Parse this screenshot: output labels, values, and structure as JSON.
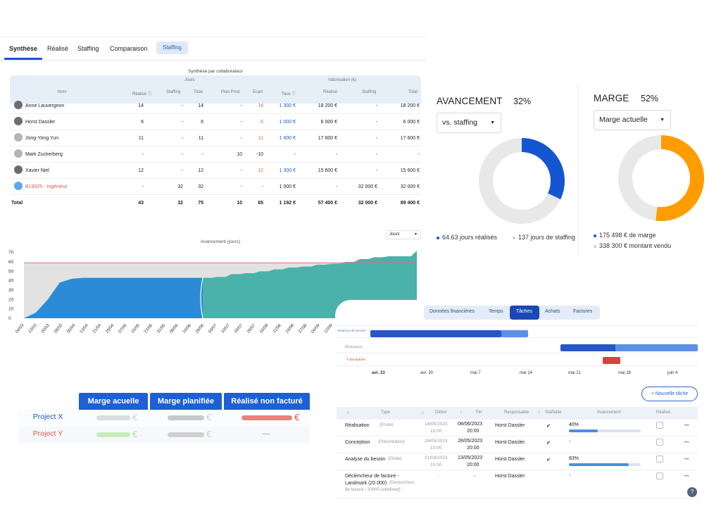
{
  "tabs": {
    "items": [
      "Synthèse",
      "Réalisé",
      "Staffing",
      "Comparaison"
    ],
    "pill": "Staffing"
  },
  "collab_table": {
    "title": "Synthèse par collaborateur",
    "group_jours": "Jours",
    "group_valo": "Valorisation (€)",
    "columns": [
      "Nom",
      "Réalisé ⓘ",
      "Staffing",
      "Total",
      "Plan Prod.",
      "Ecart",
      "Taux ⓘ",
      "Réalisé",
      "Staffing",
      "Total"
    ],
    "rows": [
      {
        "name": "Anne Lauvergeon",
        "realise": "14",
        "staffing": "-",
        "total": "14",
        "plan": "-",
        "ecart": "14",
        "taux": "1 300 €",
        "v_realise": "18 200 €",
        "v_staffing": "-",
        "v_total": "18 200 €"
      },
      {
        "name": "Horst Dassler",
        "realise": "6",
        "staffing": "-",
        "total": "6",
        "plan": "-",
        "ecart": "6",
        "taux": "1 000 €",
        "v_realise": "6 000 €",
        "v_staffing": "-",
        "v_total": "6 000 €"
      },
      {
        "name": "Jong-Yong Yun",
        "realise": "11",
        "staffing": "-",
        "total": "11",
        "plan": "-",
        "ecart": "11",
        "taux": "1 600 €",
        "v_realise": "17 600 €",
        "v_staffing": "-",
        "v_total": "17 600 €"
      },
      {
        "name": "Mark Zuckerberg",
        "realise": "-",
        "staffing": "-",
        "total": "-",
        "plan": "10",
        "ecart": "-10",
        "taux": "-",
        "v_realise": "-",
        "v_staffing": "-",
        "v_total": "-"
      },
      {
        "name": "Xavier Niel",
        "realise": "12",
        "staffing": "-",
        "total": "12",
        "plan": "-",
        "ecart": "12",
        "taux": "1 300 €",
        "v_realise": "15 600 €",
        "v_staffing": "-",
        "v_total": "15 600 €"
      },
      {
        "name": "B19325 - Ingénieur",
        "realise": "-",
        "staffing": "32",
        "total": "32",
        "plan": "-",
        "ecart": "-",
        "taux": "1 000 €",
        "v_realise": "-",
        "v_staffing": "32 000 €",
        "v_total": "32 000 €"
      }
    ],
    "total_row": {
      "name": "Total",
      "realise": "43",
      "staffing": "32",
      "total": "75",
      "plan": "10",
      "ecart": "65",
      "taux": "1 192 €",
      "v_realise": "57 400 €",
      "v_staffing": "32 000 €",
      "v_total": "89 400 €"
    }
  },
  "chart_data": [
    {
      "type": "area",
      "title": "Avancement (jours)",
      "yticks": [
        0,
        10,
        20,
        30,
        40,
        50,
        60,
        70
      ],
      "ylim": [
        0,
        72
      ],
      "xticks": [
        "04/03",
        "13/03",
        "20/03",
        "28/03",
        "05/04",
        "13/04",
        "21/04",
        "29/04",
        "07/05",
        "15/05",
        "23/05",
        "31/05",
        "08/06",
        "16/06",
        "26/06",
        "03/07",
        "10/07",
        "18/07",
        "26/07",
        "03/08",
        "11/08",
        "19/08",
        "27/08",
        "04/09",
        "12/09",
        "20/09",
        "28/09",
        "06/10",
        "14/10",
        "22/10",
        "30/10"
      ],
      "series": [
        {
          "name": "Réalisé",
          "color": "#2b8bd6",
          "values": [
            0,
            6,
            20,
            38,
            42,
            43,
            43,
            43,
            43,
            43,
            43,
            43,
            43,
            43,
            43,
            43
          ]
        },
        {
          "name": "Staffing",
          "color": "#4ab2aa",
          "values": [
            43,
            44,
            47,
            48,
            50,
            52,
            54,
            55,
            57,
            58,
            60,
            63,
            65,
            66,
            66,
            72
          ]
        }
      ],
      "reference_line": {
        "value": 59,
        "color": "#e07078"
      },
      "background_area": {
        "value": 59,
        "color": "#e2e2e2"
      },
      "period_selector": "Jours"
    },
    {
      "type": "pie",
      "title": "AVANCEMENT",
      "percent": "32%",
      "selector": "vs. staffing",
      "values": [
        32,
        68
      ],
      "colors": [
        "#1456d0",
        "#e8e8e8"
      ],
      "legend": [
        "64.63 jours réalisés",
        "137 jours de staffing"
      ]
    },
    {
      "type": "pie",
      "title": "MARGE",
      "percent": "52%",
      "selector": "Marge actuelle",
      "values": [
        52,
        48
      ],
      "colors": [
        "#ff9d00",
        "#e8e8e8"
      ],
      "legend": [
        "175 498 € de marge",
        "338 300 € montant vendu"
      ]
    }
  ],
  "marge_table": {
    "headers": [
      "Marge acuelle",
      "Marge planifiée",
      "Réalisé non facturé"
    ],
    "rows": [
      {
        "label": "Project X",
        "label_color": "#2656b8",
        "bars": [
          "#dcdcdc",
          "#c8c8c8",
          "#e8837b"
        ],
        "euro_colors": [
          "#d0d0d0",
          "#d0d0d0",
          "#e0584c"
        ],
        "third": "€"
      },
      {
        "label": "Project Y",
        "label_color": "#e0584c",
        "bars": [
          "#c7ebb8",
          "#d0d0d0",
          ""
        ],
        "euro_colors": [
          "#b9dda8",
          "#d0d0d0",
          ""
        ],
        "third": "—"
      }
    ],
    "euro_symbol": "€"
  },
  "tasks_panel": {
    "tabs": [
      "Données financières",
      "Temps",
      "Tâches",
      "Achats",
      "Factures"
    ],
    "gantt": {
      "rows": [
        "Analyse du besoin",
        "Réalisation",
        "Conception"
      ],
      "axis": [
        "avr. 23",
        "avr. 30",
        "mai 7",
        "mai 14",
        "mai 21",
        "mai 28",
        "juin 4"
      ]
    },
    "new_task_button": "+ Nouvelle tâche",
    "columns": [
      "Type",
      "Début",
      "Fin",
      "Responsable",
      "Staffable",
      "Avancement",
      "Réalisé"
    ],
    "rows": [
      {
        "type": "Réalisation",
        "sub": "(Etude)",
        "start": "18/05/2023",
        "start_time": "10:00",
        "end": "08/06/2023",
        "end_time": "20:00",
        "owner": "Horst Dassler",
        "staffable": "✔",
        "progress_label": "40%",
        "progress": 0.4
      },
      {
        "type": "Conception",
        "sub": "(Présentation)",
        "start": "24/05/2023",
        "start_time": "10:00",
        "end": "28/05/2023",
        "end_time": "20:00",
        "owner": "Horst Dassler",
        "staffable": "✔",
        "progress_label": "-",
        "progress": null
      },
      {
        "type": "Analyse du besoin",
        "sub": "(Etude)",
        "start": "21/04/2023",
        "start_time": "10:00",
        "end": "13/05/2023",
        "end_time": "20:00",
        "owner": "Horst Dassler",
        "staffable": "✔",
        "progress_label": "83%",
        "progress": 0.83
      },
      {
        "type": "Déclencheur de facture -",
        "type2": "Landmark (20 000)",
        "sub": "(Déclencheur",
        "sub2": "de facture - 20000 undefined)",
        "start": "-",
        "end": "-",
        "owner": "Horst Dassler",
        "staffable": "",
        "progress_label": "-",
        "progress": null
      }
    ],
    "more": "•••",
    "help": "?"
  }
}
